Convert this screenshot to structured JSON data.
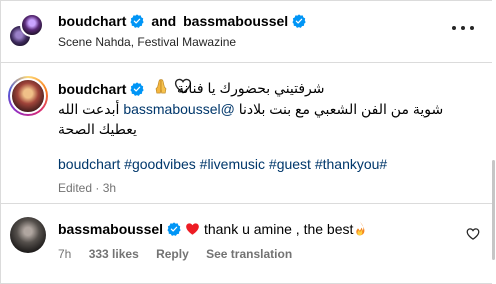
{
  "header": {
    "user1": "boudchart",
    "and": "and",
    "user2": "bassmaboussel",
    "location": "Scene Nahda, Festival Mawazine"
  },
  "caption": {
    "username": "boudchart",
    "line1": "شرفتيني بحضورك يا فنانة",
    "line2_before": "شوية من الفن الشعبي مع بنت بلادنا ",
    "mention": "@bassmaboussel",
    "line2_after": " أبدعت الله",
    "line3": "يعطيك الصحة",
    "hashtags": "boudchart #goodvibes #livemusic #guest #thankyou#",
    "edited": "Edited · 3h"
  },
  "comment": {
    "username": "bassmaboussel",
    "text": "thank u amine , the best",
    "time": "7h",
    "likes": "333 likes",
    "reply": "Reply",
    "translate": "See translation"
  },
  "colors": {
    "verified": "#0095f6",
    "link": "#00376b",
    "muted": "#737373",
    "heart_red": "#ed1c24"
  }
}
